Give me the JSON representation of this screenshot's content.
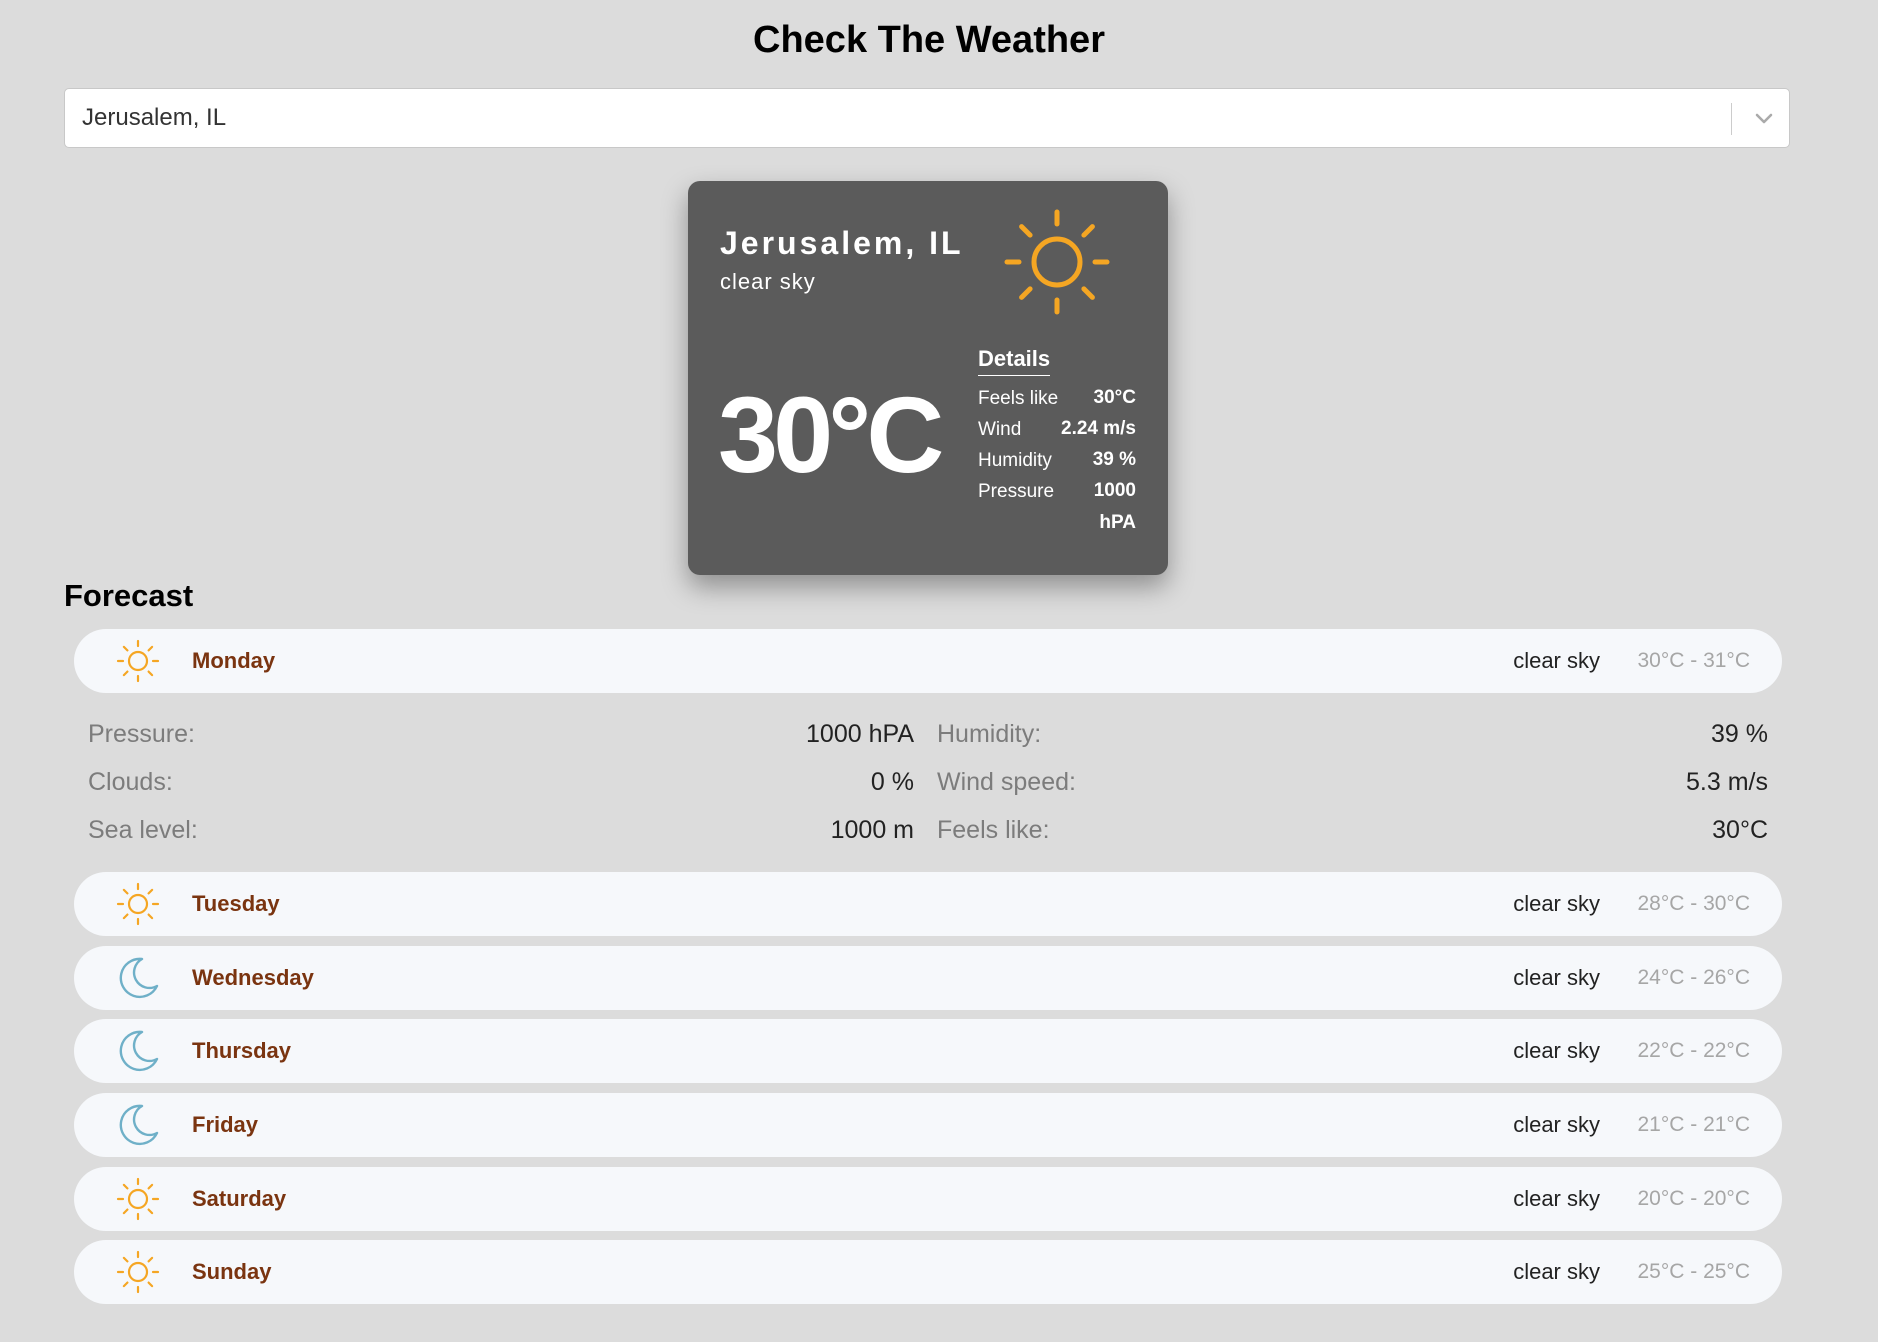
{
  "header": {
    "title": "Check The Weather"
  },
  "search": {
    "value": "Jerusalem, IL"
  },
  "current": {
    "city": "Jerusalem, IL",
    "description": "clear sky",
    "icon": "sun-icon",
    "temperature": "30°C",
    "details_title": "Details",
    "details": [
      {
        "label": "Feels like",
        "value": "30°C"
      },
      {
        "label": "Wind",
        "value": "2.24 m/s"
      },
      {
        "label": "Humidity",
        "value": "39 %"
      },
      {
        "label": "Pressure",
        "value": "1000 hPA"
      }
    ]
  },
  "forecast": {
    "title": "Forecast",
    "expanded": {
      "rows": [
        {
          "label": "Pressure:",
          "value": "1000 hPA",
          "label2": "Humidity:",
          "value2": "39 %"
        },
        {
          "label": "Clouds:",
          "value": "0 %",
          "label2": "Wind speed:",
          "value2": "5.3 m/s"
        },
        {
          "label": "Sea level:",
          "value": "1000 m",
          "label2": "Feels like:",
          "value2": "30°C"
        }
      ]
    },
    "days": [
      {
        "day": "Monday",
        "icon": "sun-icon",
        "description": "clear sky",
        "range": "30°C - 31°C"
      },
      {
        "day": "Tuesday",
        "icon": "sun-icon",
        "description": "clear sky",
        "range": "28°C - 30°C"
      },
      {
        "day": "Wednesday",
        "icon": "moon-icon",
        "description": "clear sky",
        "range": "24°C - 26°C"
      },
      {
        "day": "Thursday",
        "icon": "moon-icon",
        "description": "clear sky",
        "range": "22°C - 22°C"
      },
      {
        "day": "Friday",
        "icon": "moon-icon",
        "description": "clear sky",
        "range": "21°C - 21°C"
      },
      {
        "day": "Saturday",
        "icon": "sun-icon",
        "description": "clear sky",
        "range": "20°C - 20°C"
      },
      {
        "day": "Sunday",
        "icon": "sun-icon",
        "description": "clear sky",
        "range": "25°C - 25°C"
      }
    ]
  },
  "colors": {
    "background": "#dcdcdc",
    "card": "#5b5b5b",
    "sun": "#f5a623",
    "moon": "#6fb0c8",
    "day_name": "#7a3410",
    "range": "#a6a6a6"
  }
}
